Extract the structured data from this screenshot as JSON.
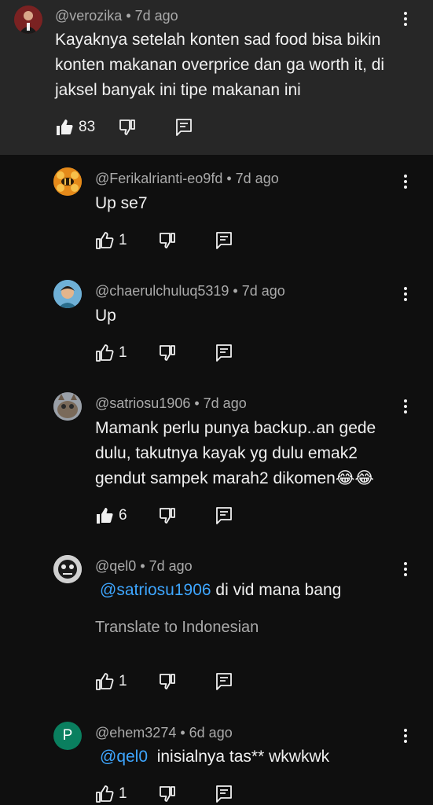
{
  "comments": [
    {
      "handle": "@verozika",
      "time": "7d ago",
      "lines": [
        "Kayaknya setelah konten sad food bisa bikin",
        "konten makanan overprice dan ga worth it, di",
        "jaksel banyak ini tipe makanan ini"
      ],
      "likes": "83"
    },
    {
      "handle": "@Ferikalrianti-eo9fd",
      "time": "7d ago",
      "lines": [
        "Up se7"
      ],
      "likes": "1"
    },
    {
      "handle": "@chaerulchuluq5319",
      "time": "7d ago",
      "lines": [
        "Up"
      ],
      "likes": "1"
    },
    {
      "handle": "@satriosu1906",
      "time": "7d ago",
      "lines": [
        "Mamank perlu punya backup..an gede",
        "dulu, takutnya kayak yg dulu emak2",
        "gendut sampek marah2 dikomen😂😂"
      ],
      "likes": "6"
    },
    {
      "handle": "@qel0",
      "time": "7d ago",
      "mention": "@satriosu1906",
      "text": "di vid mana bang",
      "translate": "Translate to Indonesian",
      "likes": "1"
    },
    {
      "handle": "@ehem3274",
      "time": "6d ago",
      "mention": "@qel0",
      "text": "inisialnya tas** wkwkwk",
      "avatar_letter": "P",
      "likes": "1"
    }
  ],
  "colors": {
    "background": "#0f0f0f",
    "highlight": "#272727",
    "mention": "#3ea6ff",
    "meta": "#aaaaaa",
    "avatar_p": "#0a7f5f"
  },
  "icons": [
    "like-icon",
    "dislike-icon",
    "reply-icon",
    "more-vert-icon"
  ]
}
